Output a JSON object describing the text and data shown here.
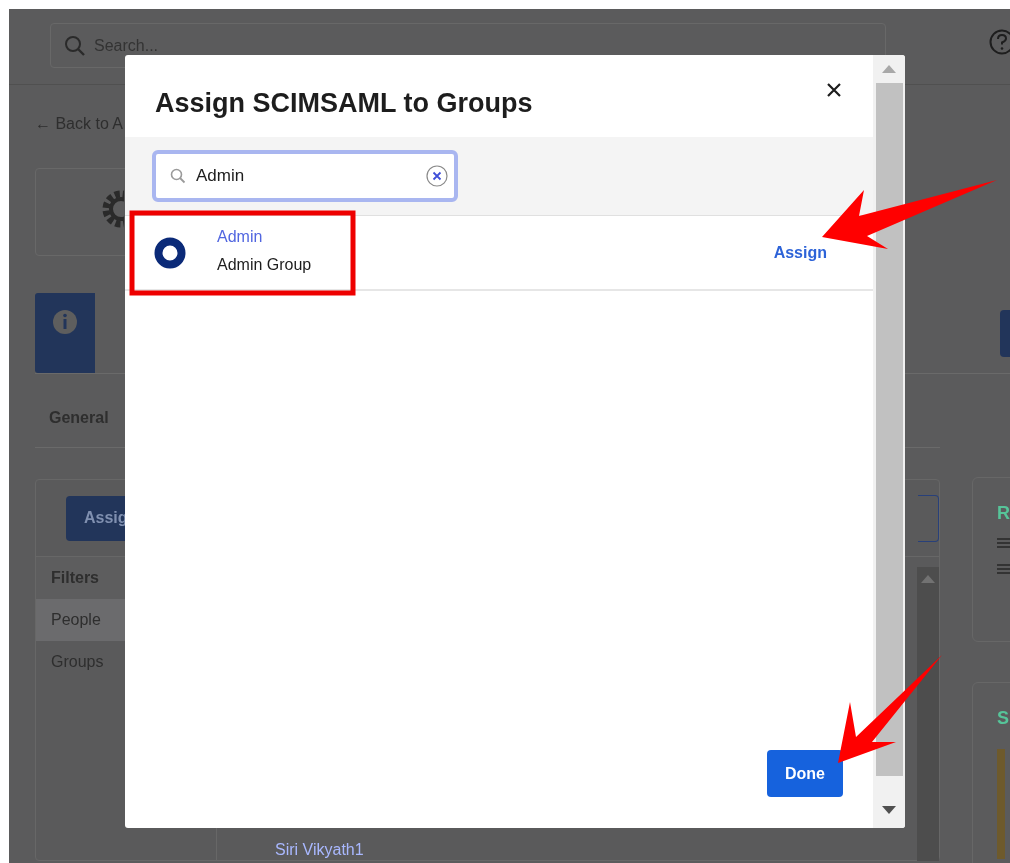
{
  "background": {
    "search": {
      "placeholder": "Search..."
    },
    "back_link": "← Back to A",
    "tab_label": "General",
    "assign_button": "Assig",
    "filters": {
      "title": "Filters",
      "items": [
        {
          "label": "People",
          "selected": true
        },
        {
          "label": "Groups",
          "selected": false
        }
      ]
    },
    "list_row": "Siri Vikyath1",
    "side_cards": [
      {
        "title": "R"
      },
      {
        "title": "S"
      }
    ]
  },
  "dialog": {
    "title": "Assign SCIMSAML to Groups",
    "search": {
      "value": "Admin"
    },
    "results": [
      {
        "name": "Admin",
        "description": "Admin Group",
        "action": "Assign"
      }
    ],
    "done_button": "Done"
  },
  "annotations": [
    {
      "kind": "box"
    },
    {
      "kind": "arrow"
    },
    {
      "kind": "arrow"
    }
  ]
}
